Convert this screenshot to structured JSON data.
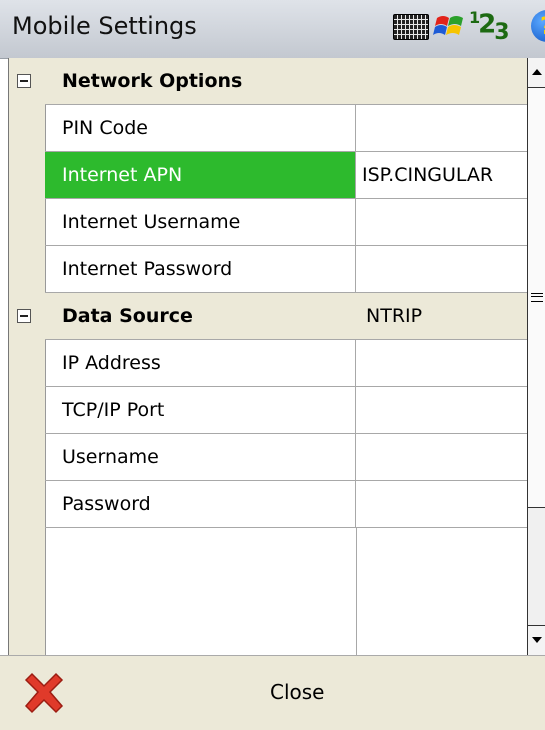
{
  "title": "Mobile Settings",
  "tray_icons": [
    "keyboard-icon",
    "windows-flag-icon",
    "input-mode-123-icon",
    "help-icon"
  ],
  "tray_input_mode": {
    "sup": "1",
    "mid": "2",
    "sub": "3"
  },
  "tray_help_glyph": "?",
  "rows": [
    {
      "type": "category",
      "name": "Network Options",
      "value": ""
    },
    {
      "type": "property",
      "name": "PIN Code",
      "value": ""
    },
    {
      "type": "property",
      "name": "Internet APN",
      "value": "ISP.CINGULAR",
      "selected": true
    },
    {
      "type": "property",
      "name": "Internet Username",
      "value": ""
    },
    {
      "type": "property",
      "name": "Internet Password",
      "value": ""
    },
    {
      "type": "category",
      "name": "Data Source",
      "value": "NTRIP"
    },
    {
      "type": "property",
      "name": "IP Address",
      "value": ""
    },
    {
      "type": "property",
      "name": "TCP/IP Port",
      "value": ""
    },
    {
      "type": "property",
      "name": "Username",
      "value": ""
    },
    {
      "type": "property",
      "name": "Password",
      "value": ""
    }
  ],
  "bottom_bar": {
    "close_label": "Close"
  },
  "colors": {
    "selected_bg": "#2dba2d",
    "category_bg": "#ece9d8",
    "close_icon": "#e03a2a"
  }
}
